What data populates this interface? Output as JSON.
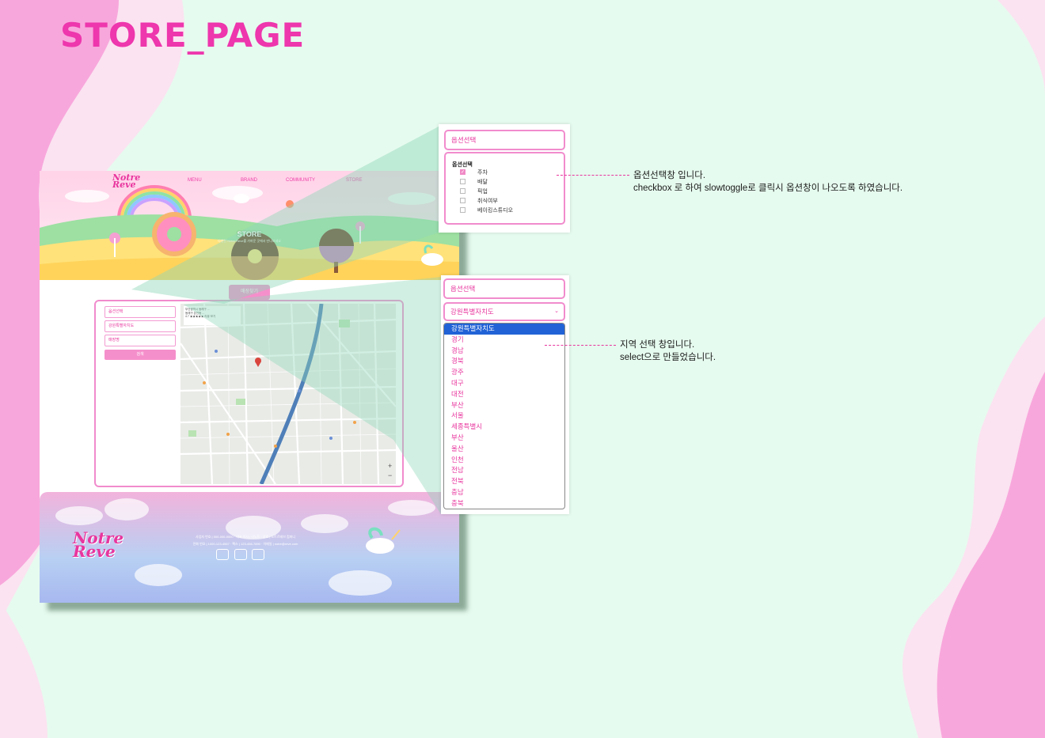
{
  "page_title": "STORE_PAGE",
  "site": {
    "logo": "Notre\nReve",
    "nav": [
      "MENU",
      "BRAND",
      "COMMUNITY",
      "STORE"
    ],
    "hero_title": "STORE",
    "hero_subtitle": "다양한 Notre Reve를 가까운 곳에서 만나보세요",
    "find_button": "매장찾기",
    "finder": {
      "option_field": "옵션선택",
      "region_field": "강원특별자치도",
      "store_name_field": "매장명",
      "search_button": "검색"
    },
    "map_card": "부산광역시 동래구 ...\n동래구 온천동 ...\n4.7 ★★★★★ 리뷰 보기",
    "footer_logo": "Notre\nReve",
    "footer_info": [
      "사업자 번호 | 000-000-0000 · 대표 이사 | 이노트 · 상호 | 노트르레브 컴퍼니",
      "전화 번호 | 1000-123-4567 · 팩스 | 123-456-7890 · 이메일 | notre@reve.com"
    ]
  },
  "option_panel": {
    "field_label": "옵션선택",
    "dropdown_title": "옵션선택",
    "items": [
      {
        "label": "주차",
        "checked": true
      },
      {
        "label": "배달",
        "checked": false
      },
      {
        "label": "픽업",
        "checked": false
      },
      {
        "label": "취식여부",
        "checked": false
      },
      {
        "label": "베이킹스튜디오",
        "checked": false
      }
    ]
  },
  "region_panel": {
    "field_label": "옵션선택",
    "select_value": "강원특별자치도",
    "options": [
      "강원특별자치도",
      "경기",
      "경남",
      "경북",
      "광주",
      "대구",
      "대전",
      "부산",
      "서울",
      "세종특별시",
      "부산",
      "울산",
      "인천",
      "전남",
      "전북",
      "충남",
      "충북"
    ],
    "selected_index": 0
  },
  "notes": {
    "option_note": [
      "옵션선택창 입니다.",
      "checkbox 로 하여 slowtoggle로 클릭시 옵션창이 나오도록 하였습니다."
    ],
    "region_note": [
      "지역 선택 창입니다.",
      "select으로 만들었습니다."
    ]
  },
  "colors": {
    "accent_pink": "#e8359e",
    "border_pink": "#f18ccd",
    "background_mint": "#e6fbef",
    "select_highlight": "#2162d6"
  },
  "icons": [
    "instagram-icon",
    "youtube-icon",
    "gallery-icon",
    "map-pin-icon",
    "unicorn-illustration",
    "rainbow-illustration",
    "donut-illustration"
  ]
}
